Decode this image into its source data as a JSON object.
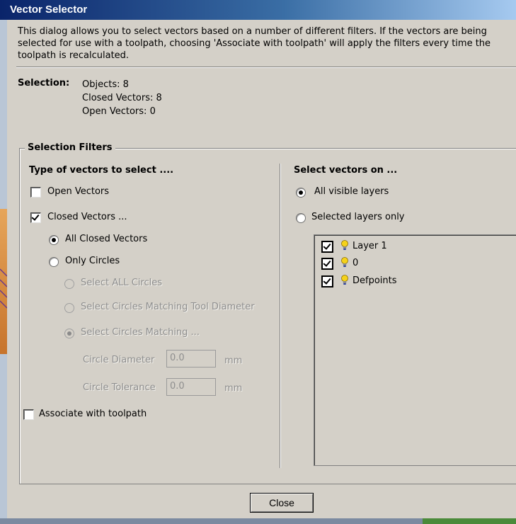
{
  "window": {
    "title": "Vector Selector"
  },
  "description": "This dialog allows you to select vectors based on a number of different filters. If the vectors are being selected for use with a toolpath, choosing 'Associate with toolpath' will apply the filters every time the toolpath is recalculated.",
  "selection": {
    "label": "Selection:",
    "objects": "Objects: 8",
    "closed": "Closed Vectors: 8",
    "open": "Open Vectors: 0"
  },
  "filters": {
    "title": "Selection Filters",
    "type_heading": "Type of vectors to select ....",
    "open_vectors": {
      "label": "Open Vectors",
      "checked": false
    },
    "closed_vectors": {
      "label": "Closed Vectors ...",
      "checked": true
    },
    "all_closed": {
      "label": "All Closed Vectors",
      "selected": true
    },
    "only_circles": {
      "label": "Only Circles",
      "selected": false
    },
    "select_all_circles": "Select ALL Circles",
    "select_matching_tool": "Select Circles Matching Tool Diameter",
    "select_matching": "Select Circles Matching ...",
    "circle_diameter": {
      "label": "Circle Diameter",
      "value": "0.0",
      "unit": "mm"
    },
    "circle_tolerance": {
      "label": "Circle Tolerance",
      "value": "0.0",
      "unit": "mm"
    },
    "associate": {
      "label": "Associate with toolpath",
      "checked": false
    },
    "layers_heading": "Select vectors on ...",
    "all_visible_layers": {
      "label": "All visible layers",
      "selected": true
    },
    "selected_layers_only": {
      "label": "Selected layers only",
      "selected": false
    },
    "layers": [
      {
        "name": "Layer 1",
        "checked": true,
        "icon": "lightbulb-icon"
      },
      {
        "name": "0",
        "checked": true,
        "icon": "lightbulb-icon"
      },
      {
        "name": "Defpoints",
        "checked": true,
        "icon": "lightbulb-icon"
      }
    ]
  },
  "buttons": {
    "close": "Close"
  },
  "colors": {
    "title_bar_start": "#0a246a",
    "title_bar_end": "#a6caf0",
    "dialog_bg": "#d4d0c8",
    "bulb": "#f5d21a"
  }
}
